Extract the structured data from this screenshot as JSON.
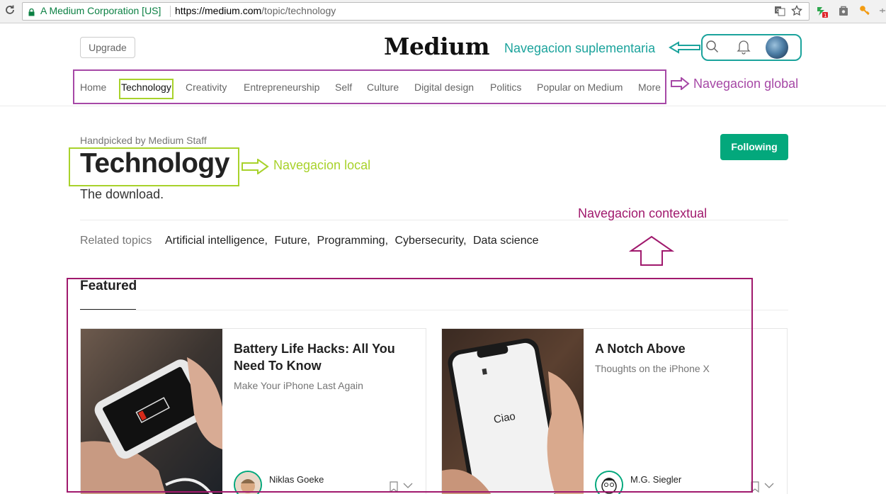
{
  "browser": {
    "site_identity": "A Medium Corporation [US]",
    "url_host": "https://medium.com",
    "url_path": "/topic/technology",
    "extension_badge": "1"
  },
  "header": {
    "upgrade_label": "Upgrade",
    "logo": "Medium"
  },
  "nav": {
    "items": [
      {
        "label": "Home"
      },
      {
        "label": "Technology",
        "active": true
      },
      {
        "label": "Creativity"
      },
      {
        "label": "Entrepreneurship"
      },
      {
        "label": "Self"
      },
      {
        "label": "Culture"
      },
      {
        "label": "Digital design"
      },
      {
        "label": "Politics"
      },
      {
        "label": "Popular on Medium"
      },
      {
        "label": "More"
      }
    ]
  },
  "topic": {
    "curator": "Handpicked by Medium Staff",
    "title": "Technology",
    "description": "The download.",
    "follow_label": "Following",
    "related_label": "Related topics",
    "related": [
      "Artificial intelligence,",
      "Future,",
      "Programming,",
      "Cybersecurity,",
      "Data science"
    ]
  },
  "featured": {
    "label": "Featured",
    "cards": [
      {
        "title": "Battery Life Hacks: All You Need To Know",
        "subtitle": "Make Your iPhone Last Again",
        "author": "Niklas Goeke",
        "image_screen_text": "",
        "image_icon": "low-battery-phone-photo"
      },
      {
        "title": "A Notch Above",
        "subtitle": "Thoughts on the iPhone X",
        "author": "M.G. Siegler",
        "image_screen_text": "Ciao",
        "image_icon": "iphone-x-photo"
      }
    ]
  },
  "annotations": {
    "supplementary": "Navegacion suplementaria",
    "global": "Navegacion global",
    "local": "Navegacion local",
    "contextual": "Navegacion contextual",
    "colors": {
      "supplementary": "#1ba39c",
      "global": "#a648a6",
      "local": "#a8d22b",
      "contextual": "#a0196d"
    }
  },
  "colors": {
    "accent": "#03a87c"
  }
}
